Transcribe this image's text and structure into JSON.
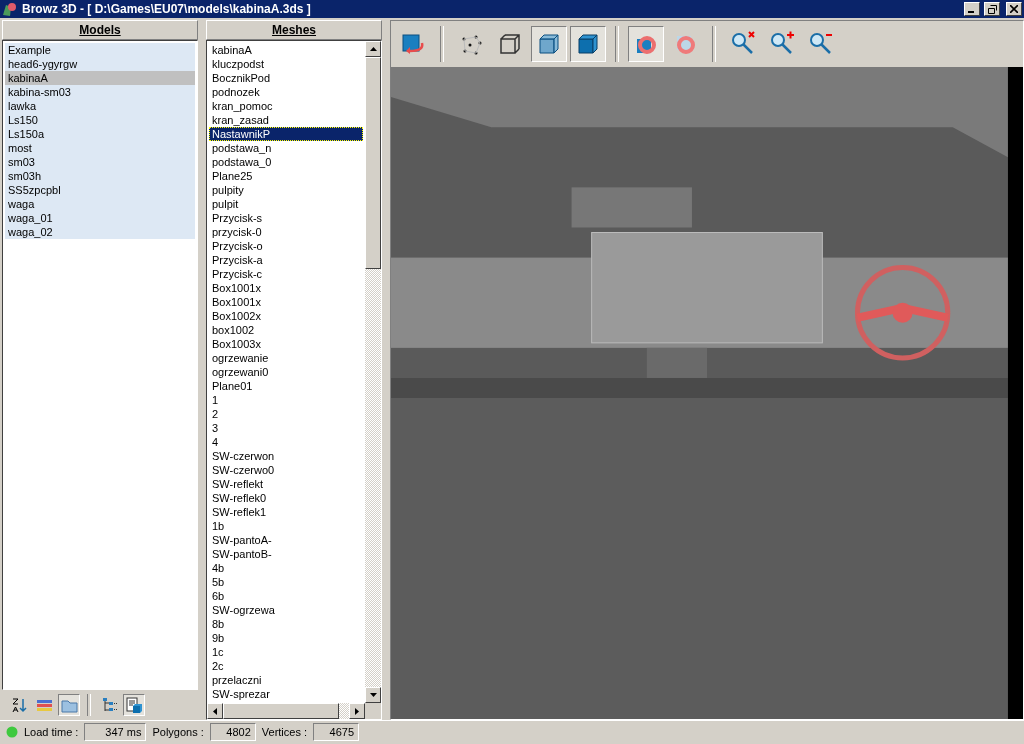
{
  "window": {
    "title": "Browz 3D - [ D:\\Games\\EU07\\models\\kabinaA.3ds ]"
  },
  "models": {
    "header": "Models",
    "items": [
      {
        "label": "Example",
        "selected": false
      },
      {
        "label": "head6-ygyrgw",
        "selected": false
      },
      {
        "label": "kabinaA",
        "selected": true
      },
      {
        "label": "kabina-sm03",
        "selected": false
      },
      {
        "label": "lawka",
        "selected": false
      },
      {
        "label": "Ls150",
        "selected": false
      },
      {
        "label": "Ls150a",
        "selected": false
      },
      {
        "label": "most",
        "selected": false
      },
      {
        "label": "sm03",
        "selected": false
      },
      {
        "label": "sm03h",
        "selected": false
      },
      {
        "label": "SS5zpcpbl",
        "selected": false
      },
      {
        "label": "waga",
        "selected": false
      },
      {
        "label": "waga_01",
        "selected": false
      },
      {
        "label": "waga_02",
        "selected": false
      }
    ],
    "toolbar": [
      {
        "kind": "sort",
        "pressed": false
      },
      {
        "kind": "colors",
        "pressed": false
      },
      {
        "kind": "folder",
        "pressed": true
      },
      {
        "kind": "sep"
      },
      {
        "kind": "tree",
        "pressed": false
      },
      {
        "kind": "doc",
        "pressed": true
      }
    ]
  },
  "meshes": {
    "header": "Meshes",
    "items": [
      {
        "label": "kabinaA",
        "selected": false
      },
      {
        "label": "kluczpodst",
        "selected": false
      },
      {
        "label": "BocznikPod",
        "selected": false
      },
      {
        "label": "podnozek",
        "selected": false
      },
      {
        "label": "kran_pomoc",
        "selected": false
      },
      {
        "label": "kran_zasad",
        "selected": false
      },
      {
        "label": "NastawnikP",
        "selected": true
      },
      {
        "label": "podstawa_n",
        "selected": false
      },
      {
        "label": "podstawa_0",
        "selected": false
      },
      {
        "label": "Plane25",
        "selected": false
      },
      {
        "label": "pulpity",
        "selected": false
      },
      {
        "label": "pulpit",
        "selected": false
      },
      {
        "label": "Przycisk-s",
        "selected": false
      },
      {
        "label": "przycisk-0",
        "selected": false
      },
      {
        "label": "Przycisk-o",
        "selected": false
      },
      {
        "label": "Przycisk-a",
        "selected": false
      },
      {
        "label": "Przycisk-c",
        "selected": false
      },
      {
        "label": "Box1001x",
        "selected": false
      },
      {
        "label": "Box1001x",
        "selected": false
      },
      {
        "label": "Box1002x",
        "selected": false
      },
      {
        "label": "box1002",
        "selected": false
      },
      {
        "label": "Box1003x",
        "selected": false
      },
      {
        "label": "ogrzewanie",
        "selected": false
      },
      {
        "label": "ogrzewani0",
        "selected": false
      },
      {
        "label": "Plane01",
        "selected": false
      },
      {
        "label": "1",
        "selected": false
      },
      {
        "label": "2",
        "selected": false
      },
      {
        "label": "3",
        "selected": false
      },
      {
        "label": "4",
        "selected": false
      },
      {
        "label": "SW-czerwon",
        "selected": false
      },
      {
        "label": "SW-czerwo0",
        "selected": false
      },
      {
        "label": "SW-reflekt",
        "selected": false
      },
      {
        "label": "SW-reflek0",
        "selected": false
      },
      {
        "label": "SW-reflek1",
        "selected": false
      },
      {
        "label": "1b",
        "selected": false
      },
      {
        "label": "SW-pantoA-",
        "selected": false
      },
      {
        "label": "SW-pantoB-",
        "selected": false
      },
      {
        "label": "4b",
        "selected": false
      },
      {
        "label": "5b",
        "selected": false
      },
      {
        "label": "6b",
        "selected": false
      },
      {
        "label": "SW-ogrzewa",
        "selected": false
      },
      {
        "label": "8b",
        "selected": false
      },
      {
        "label": "9b",
        "selected": false
      },
      {
        "label": "1c",
        "selected": false
      },
      {
        "label": "2c",
        "selected": false
      },
      {
        "label": "przelaczni",
        "selected": false
      },
      {
        "label": "SW-sprezar",
        "selected": false
      }
    ]
  },
  "toolbar": [
    {
      "kind": "rotate",
      "pressed": false
    },
    {
      "kind": "sep"
    },
    {
      "kind": "points",
      "pressed": false
    },
    {
      "kind": "wire",
      "pressed": false
    },
    {
      "kind": "glass",
      "pressed": true
    },
    {
      "kind": "solid",
      "pressed": true
    },
    {
      "kind": "sep"
    },
    {
      "kind": "cull",
      "pressed": true
    },
    {
      "kind": "torus",
      "pressed": false
    },
    {
      "kind": "sep"
    },
    {
      "kind": "zoomreset",
      "pressed": false
    },
    {
      "kind": "zoomin",
      "pressed": false
    },
    {
      "kind": "zoomout",
      "pressed": false
    }
  ],
  "status": {
    "load_label": "Load time :",
    "load_value": "347 ms",
    "polygons_label": "Polygons :",
    "polygons_value": "4802",
    "vertices_label": "Vertices :",
    "vertices_value": "4675"
  }
}
